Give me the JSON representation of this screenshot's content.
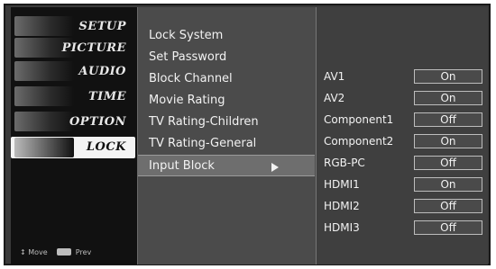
{
  "categories": [
    {
      "label": "SETUP",
      "icon": "setup-icon"
    },
    {
      "label": "PICTURE",
      "icon": "picture-icon"
    },
    {
      "label": "AUDIO",
      "icon": "audio-icon"
    },
    {
      "label": "TIME",
      "icon": "time-icon"
    },
    {
      "label": "OPTION",
      "icon": "option-icon"
    },
    {
      "label": "LOCK",
      "icon": "lock-icon",
      "selected": true
    }
  ],
  "footer": {
    "move_label": "Move",
    "prev_label": "Prev"
  },
  "menu": {
    "items": [
      {
        "label": "Lock System"
      },
      {
        "label": "Set Password"
      },
      {
        "label": "Block Channel"
      },
      {
        "label": "Movie Rating"
      },
      {
        "label": "TV Rating-Children"
      },
      {
        "label": "TV Rating-General"
      },
      {
        "label": "Input Block",
        "selected": true,
        "has_submenu": true
      }
    ]
  },
  "input_block": {
    "rows": [
      {
        "label": "AV1",
        "value": "On"
      },
      {
        "label": "AV2",
        "value": "On"
      },
      {
        "label": "Component1",
        "value": "Off"
      },
      {
        "label": "Component2",
        "value": "On"
      },
      {
        "label": "RGB-PC",
        "value": "Off"
      },
      {
        "label": "HDMI1",
        "value": "On"
      },
      {
        "label": "HDMI2",
        "value": "Off"
      },
      {
        "label": "HDMI3",
        "value": "Off"
      }
    ]
  },
  "colors": {
    "selected_bg": "#f4f4f4",
    "menu_bg": "#4b4b4b",
    "submenu_bg": "#3f3f3f"
  }
}
